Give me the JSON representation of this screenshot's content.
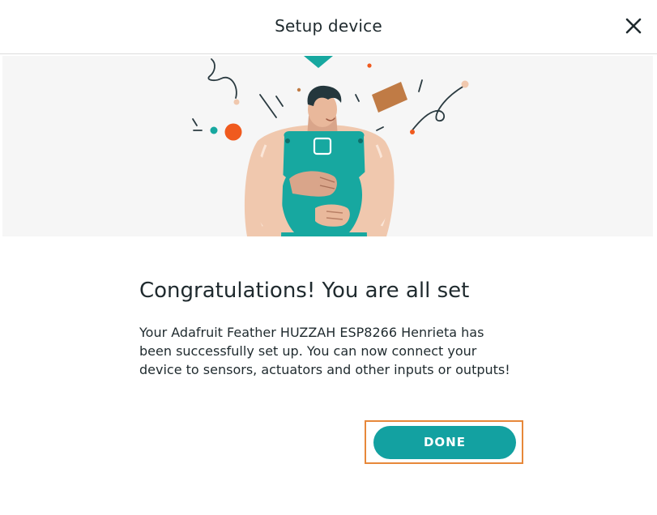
{
  "dialog": {
    "title": "Setup device",
    "close_icon": "close-icon"
  },
  "illustration": {
    "description_icon": "celebration-illustration",
    "colors": {
      "board": "#17a8a0",
      "skin": "#f0c8ae",
      "hair": "#24373d",
      "accent_orange": "#f05a1e",
      "box": "#c07b45"
    }
  },
  "content": {
    "heading": "Congratulations! You are all set",
    "message": "Your Adafruit Feather HUZZAH ESP8266 Henrieta has been successfully set up. You can now connect your device to sensors, actuators and other inputs or outputs!"
  },
  "actions": {
    "done_label": "DONE"
  },
  "colors": {
    "primary_button": "#13a1a1",
    "focus_ring": "#e7883a"
  }
}
